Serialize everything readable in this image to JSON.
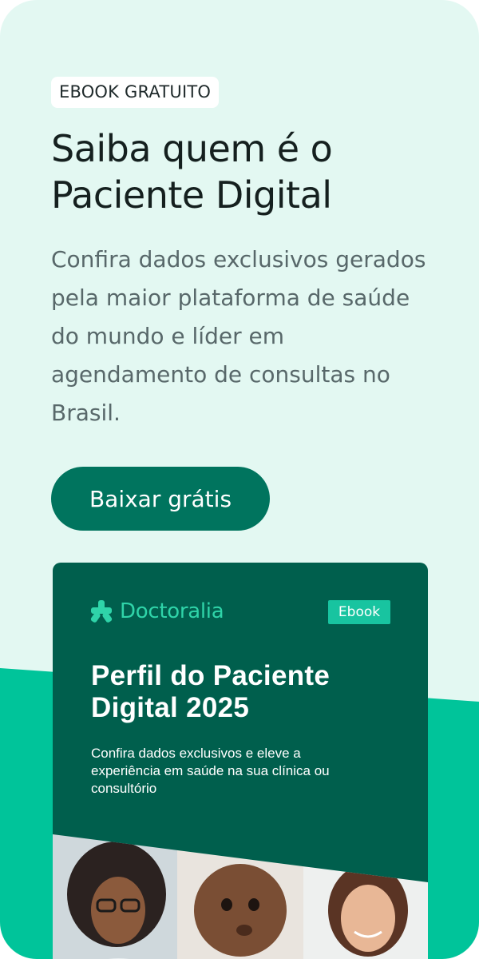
{
  "hero": {
    "badge": "EBOOK GRATUITO",
    "title_line1": "Saiba quem é o",
    "title_line2": "Paciente Digital",
    "description": "Confira dados exclusivos gerados pela maior plataforma de saúde do mundo e líder em agendamento de consultas no Brasil.",
    "cta_label": "Baixar grátis"
  },
  "ebook_cover": {
    "brand": "Doctoralia",
    "brand_icon": "doctoralia-star-icon",
    "tag": "Ebook",
    "title_line1": "Perfil do Paciente",
    "title_line2": "Digital 2025",
    "subtitle": "Confira dados exclusivos e eleve a experiência em saúde na sua clínica ou consultório",
    "photos": [
      "woman-with-glasses-photo",
      "baby-photo",
      "smiling-woman-photo"
    ]
  },
  "colors": {
    "background": "#e3f8f2",
    "accent_wave": "#00c49a",
    "cta": "#00745e",
    "cover": "#005f4d",
    "brand_green": "#2fd4a9"
  }
}
